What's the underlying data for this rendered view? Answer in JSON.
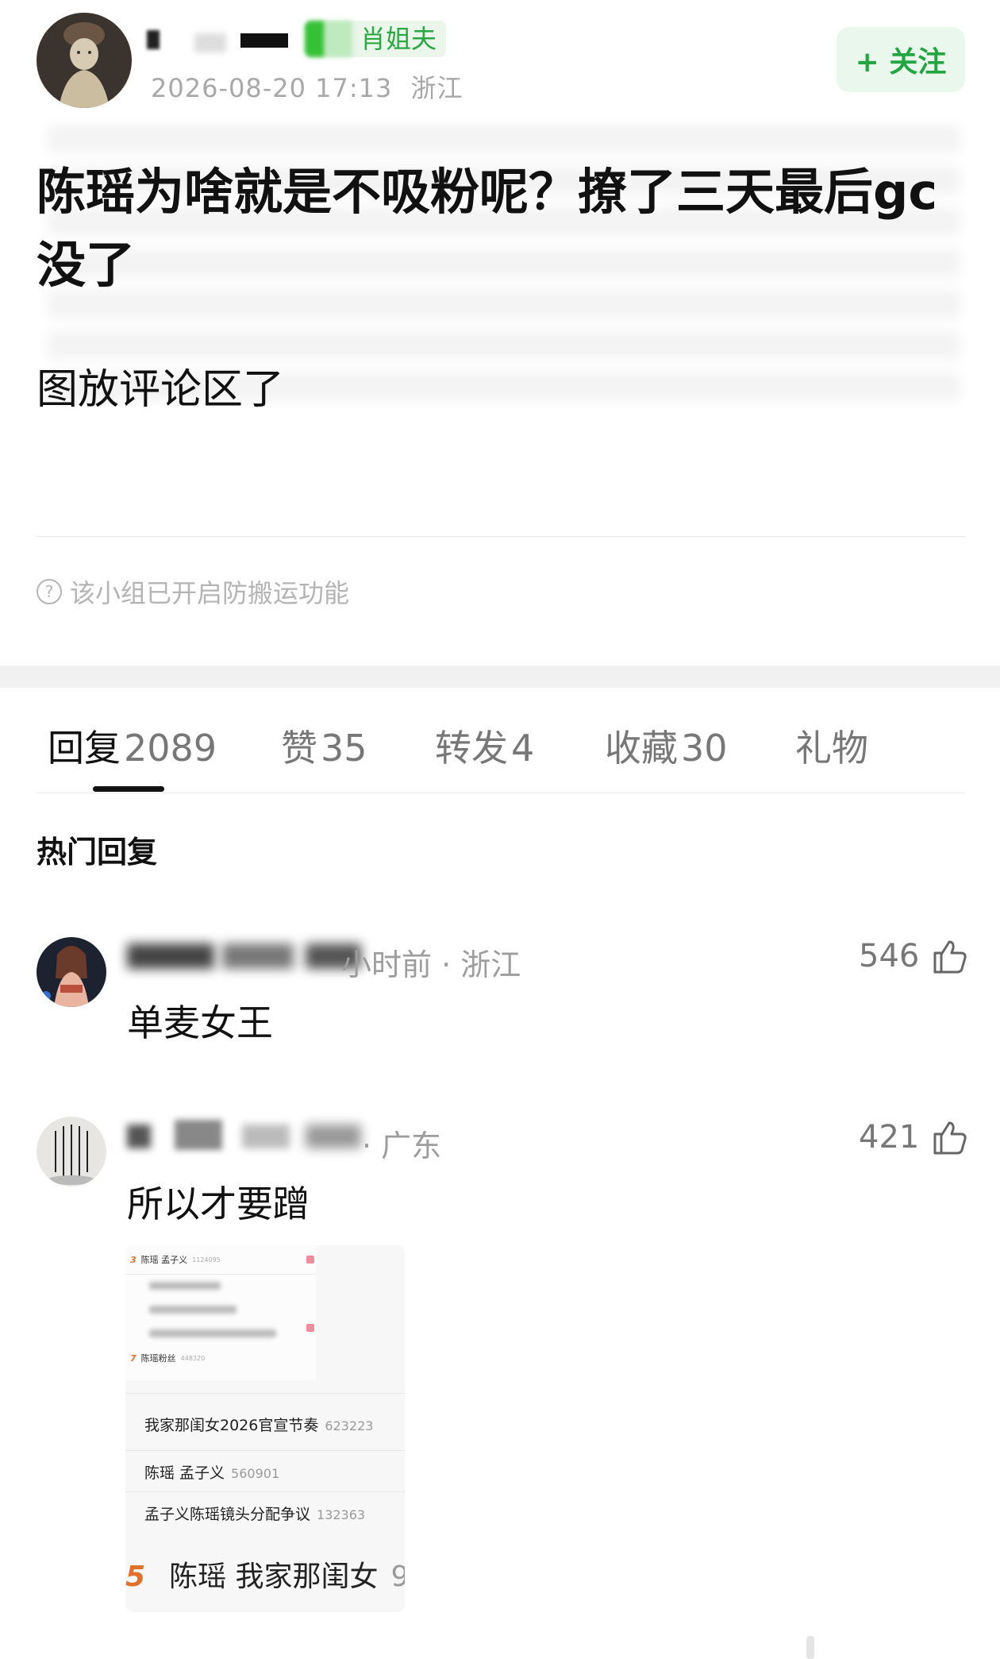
{
  "post": {
    "author_name": "",
    "badge": "肖姐夫",
    "date": "2026-08-20 17:13",
    "location": "浙江",
    "follow_label": "+ 关注",
    "title": "陈瑶为啥就是不吸粉呢？撩了三天最后gc没了",
    "body": "图放评论区了"
  },
  "notice": {
    "icon": "question-circle-icon",
    "text": "该小组已开启防搬运功能"
  },
  "tabs": [
    {
      "label": "回复",
      "count": "2089"
    },
    {
      "label": "赞",
      "count": "35"
    },
    {
      "label": "转发",
      "count": "4"
    },
    {
      "label": "收藏",
      "count": "30"
    },
    {
      "label": "礼物",
      "count": ""
    }
  ],
  "hot_replies_title": "热门回复",
  "comments": [
    {
      "meta": "小时前 · 浙江",
      "text": "单麦女王",
      "likes": "546"
    },
    {
      "meta": "· 广东",
      "text": "所以才要蹭",
      "likes": "421",
      "image": {
        "ranking_top": [
          {
            "rank": "3",
            "name": "陈瑶 孟子义",
            "num": "1124095"
          },
          {
            "rank": "7",
            "name": "陈瑶粉丝",
            "num": "448320"
          }
        ],
        "items": [
          {
            "name": "我家那闺女2026官宣节奏",
            "num": "623223"
          },
          {
            "name": "陈瑶 孟子义",
            "num": "560901"
          },
          {
            "name": "孟子义陈瑶镜头分配争议",
            "num": "132363"
          }
        ],
        "bottom": {
          "rank": "5",
          "name": "陈瑶 我家那闺女",
          "cut": "9"
        }
      }
    }
  ],
  "colors": {
    "accent_green": "#23a541",
    "follow_bg": "#e9f7ec",
    "rank_orange": "#e0702a"
  }
}
